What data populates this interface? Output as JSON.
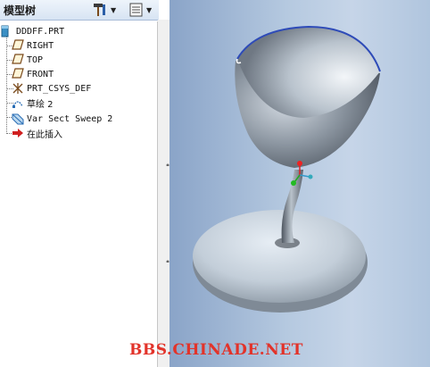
{
  "panel": {
    "title": "模型树",
    "tools": [
      {
        "icon": "hammer-settings-icon"
      },
      {
        "icon": "list-settings-icon"
      }
    ]
  },
  "tree": {
    "items": [
      {
        "label": "DDDFF.PRT",
        "icon": "part-icon"
      },
      {
        "label": "RIGHT",
        "icon": "datum-plane-icon"
      },
      {
        "label": "TOP",
        "icon": "datum-plane-icon"
      },
      {
        "label": "FRONT",
        "icon": "datum-plane-icon"
      },
      {
        "label": "PRT_CSYS_DEF",
        "icon": "coordinate-system-icon"
      },
      {
        "label": "草绘 2",
        "icon": "sketch-icon"
      },
      {
        "label": "Var Sect Sweep 2",
        "icon": "sweep-feature-icon"
      },
      {
        "label": "在此插入",
        "icon": "insert-here-arrow-icon"
      }
    ]
  },
  "viewport": {
    "watermark": "BBS.CHINADE.NET",
    "colors": {
      "background": "#b5c9e0",
      "model": "#9aa3ad",
      "watermark": "#e2332a"
    }
  }
}
